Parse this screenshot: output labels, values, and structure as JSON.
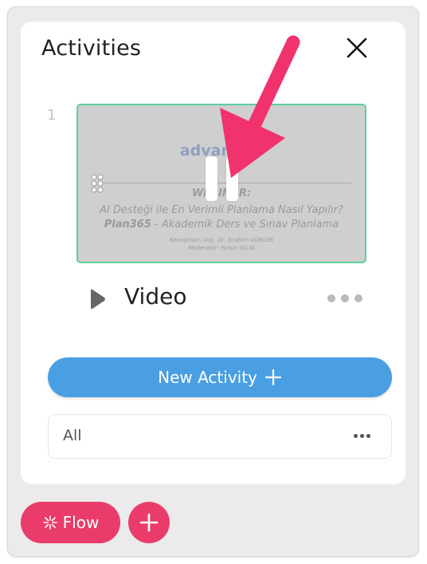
{
  "panel": {
    "title": "Activities",
    "close_icon": "close-icon"
  },
  "activities": [
    {
      "index": "1",
      "thumbnail": {
        "brand": "advancity",
        "heading": "WEBINAR:",
        "line1": "AI Desteği ile En Verimli Planlama Nasıl Yapılır?",
        "line2_bold": "Plan365",
        "line2_rest": " - Akademik Ders ve Sınav Planlama",
        "credit1": "Konuşmacı: Doç. Dr. İbrahim GÜRLER",
        "credit2": "Moderatör: Yunus YALIN"
      },
      "type_icon": "play-icon",
      "label": "Video",
      "menu_icon": "more-horizontal-icon"
    }
  ],
  "new_activity": {
    "label": "New Activity",
    "icon": "plus-icon"
  },
  "filter": {
    "label": "All",
    "menu_icon": "ellipsis-icon"
  },
  "footer": {
    "flow_label": "Flow",
    "flow_icon": "sparkle-icon",
    "add_icon": "plus-icon"
  },
  "colors": {
    "accent_blue": "#4a9fe2",
    "accent_pink": "#ea3c6a",
    "thumbnail_border": "#5fcf9f",
    "arrow_annotation": "#f0336d"
  }
}
